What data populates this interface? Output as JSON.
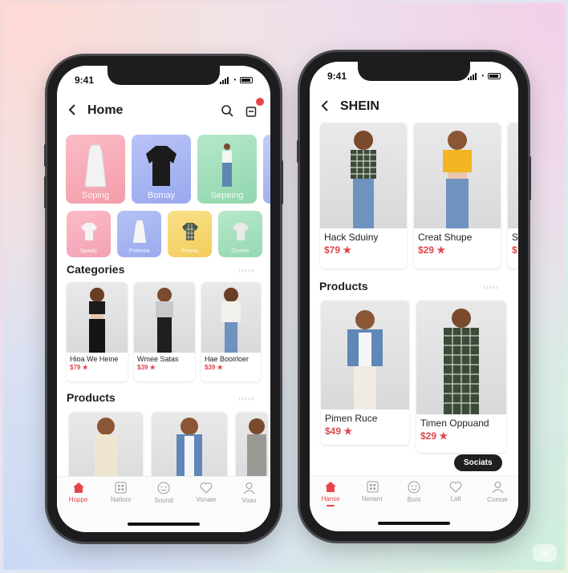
{
  "left_phone": {
    "status_time": "9:41",
    "header_title": "Home",
    "top_tiles": [
      {
        "label": "Soping",
        "color": "#f7a9b5"
      },
      {
        "label": "Bomay",
        "color": "#a9b7f1"
      },
      {
        "label": "Sepeing",
        "color": "#9ddcb7"
      }
    ],
    "mini_tiles": [
      {
        "label": "Spealy",
        "color": "#f6a6b6"
      },
      {
        "label": "Potimea",
        "color": "#a6b4ef"
      },
      {
        "label": "Peonis",
        "color": "#f7d96e"
      },
      {
        "label": "Ocmon",
        "color": "#9edbb6"
      }
    ],
    "categories_title": "Categories",
    "categories_more": "›››››",
    "categories": [
      {
        "name": "Hioa We Heine",
        "price": "$79 ★"
      },
      {
        "name": "Wmee Satas",
        "price": "$39 ★"
      },
      {
        "name": "Hae Booirloer",
        "price": "$39 ★"
      }
    ],
    "products_title": "Products",
    "products_more": "›››››",
    "tabs": [
      {
        "label": "Hoppe",
        "icon": "home-icon",
        "active": true
      },
      {
        "label": "Natlonr",
        "icon": "grid-icon",
        "active": false
      },
      {
        "label": "Sound",
        "icon": "smile-icon",
        "active": false
      },
      {
        "label": "Vonaer",
        "icon": "heart-icon",
        "active": false
      },
      {
        "label": "Voao",
        "icon": "user-icon",
        "active": false
      }
    ]
  },
  "right_phone": {
    "status_time": "9:41",
    "header_title": "SHEIN",
    "featured": [
      {
        "name": "Hack Sduiny",
        "price": "$79 ★"
      },
      {
        "name": "Creat Shupe",
        "price": "$29 ★"
      },
      {
        "name": "S",
        "price": "$"
      }
    ],
    "products_title": "Products",
    "products_more": "›››››",
    "products": [
      {
        "name": "Pimen Ruce",
        "price": "$49 ★"
      },
      {
        "name": "Timen Oppuand",
        "price": "$29 ★"
      }
    ],
    "toast": "Sociats",
    "tabs": [
      {
        "label": "Hanse",
        "icon": "home-icon",
        "active": true
      },
      {
        "label": "Nenanr",
        "icon": "grid-icon",
        "active": false
      },
      {
        "label": "Bont",
        "icon": "smile-icon",
        "active": false
      },
      {
        "label": "Lalt",
        "icon": "heart-icon",
        "active": false
      },
      {
        "label": "Comoe",
        "icon": "user-icon",
        "active": false
      }
    ]
  },
  "watermark": "ai",
  "colors": {
    "accent": "#e8454a",
    "price": "#e0464c"
  }
}
